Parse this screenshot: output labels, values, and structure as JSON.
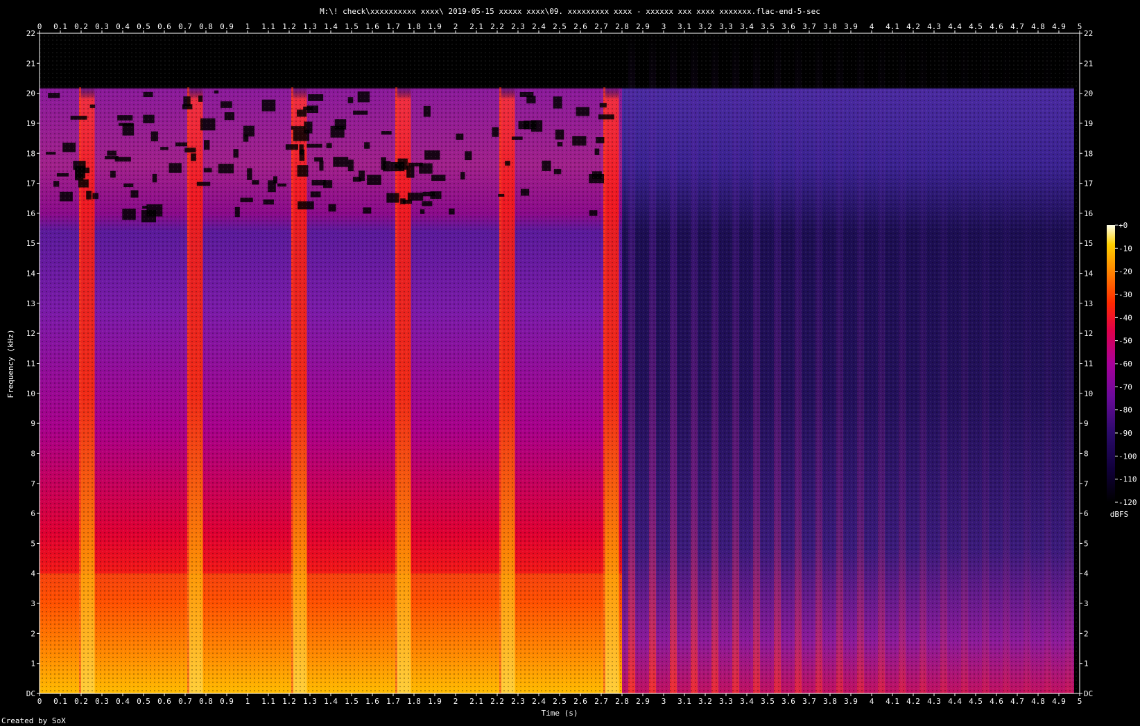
{
  "chart_data": {
    "type": "heatmap",
    "title": "M:\\! check\\xxxxxxxxxx xxxx\\ 2019-05-15  xxxxx xxxx\\09. xxxxxxxxx xxxx - xxxxxx xxx xxxx xxxxxxx.flac-end-5-sec",
    "xlabel": "Time (s)",
    "ylabel": "Frequency (kHz)",
    "xlim": [
      0,
      5
    ],
    "ylim": [
      0,
      22
    ],
    "x_ticks": [
      "0",
      "0.1",
      "0.2",
      "0.3",
      "0.4",
      "0.5",
      "0.6",
      "0.7",
      "0.8",
      "0.9",
      "1",
      "1.1",
      "1.2",
      "1.3",
      "1.4",
      "1.5",
      "1.6",
      "1.7",
      "1.8",
      "1.9",
      "2",
      "2.1",
      "2.2",
      "2.3",
      "2.4",
      "2.5",
      "2.6",
      "2.7",
      "2.8",
      "2.9",
      "3",
      "3.1",
      "3.2",
      "3.3",
      "3.4",
      "3.5",
      "3.6",
      "3.7",
      "3.8",
      "3.9",
      "4",
      "4.1",
      "4.2",
      "4.3",
      "4.4",
      "4.5",
      "4.6",
      "4.7",
      "4.8",
      "4.9",
      "5"
    ],
    "y_ticks": [
      "DC",
      "1",
      "2",
      "3",
      "4",
      "5",
      "6",
      "7",
      "8",
      "9",
      "10",
      "11",
      "12",
      "13",
      "14",
      "15",
      "16",
      "17",
      "18",
      "19",
      "20",
      "21",
      "22"
    ],
    "colorbar": {
      "label": "dBFS",
      "range": [
        -120,
        0
      ],
      "ticks": [
        "+0",
        "-10",
        "-20",
        "-30",
        "-40",
        "-50",
        "-60",
        "-70",
        "-80",
        "-90",
        "-100",
        "-110",
        "-120"
      ]
    },
    "intensity_dbfs": {
      "note": "approximate energy per time segment",
      "segments": [
        {
          "t": [
            0.0,
            2.8
          ],
          "lowband_0_4khz": -25,
          "midband_4_16khz": -65,
          "band_16_20khz": -85,
          "above_20khz": -120
        },
        {
          "t": [
            2.8,
            5.0
          ],
          "lowband_0_4khz": -70,
          "midband_4_16khz": -95,
          "band_16_20khz": -95,
          "above_20khz": -120
        }
      ],
      "transient_times_s": [
        0.2,
        0.72,
        1.22,
        1.72,
        2.22,
        2.72
      ],
      "spectrum_cutoff_khz": 20.2
    }
  },
  "footer": {
    "credit": "Created by SoX"
  },
  "colors": {
    "background": "#000000",
    "axis": "#ffffff",
    "heat_low": "#00001a",
    "heat_mid_low": "#3b0a8a",
    "heat_mid": "#a000a8",
    "heat_high": "#ff1a00",
    "heat_peak": "#ffffb0"
  }
}
